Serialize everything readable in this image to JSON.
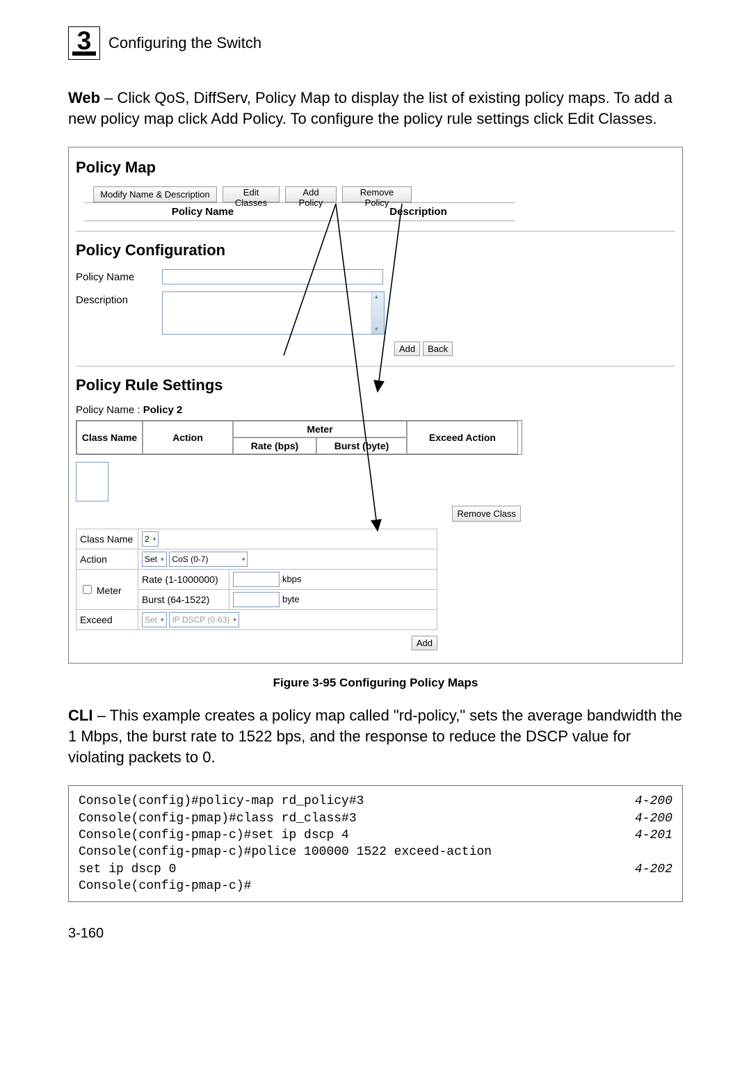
{
  "chapter": {
    "number": "3",
    "title": "Configuring the Switch"
  },
  "web_paragraph": {
    "bold": "Web",
    "rest": " – Click QoS, DiffServ, Policy Map to display the list of existing policy maps. To add a new policy map click Add Policy. To configure the policy rule settings click Edit Classes."
  },
  "policy_map": {
    "title": "Policy Map",
    "buttons": {
      "modify": "Modify Name & Description",
      "edit_classes": "Edit Classes",
      "add_policy": "Add Policy",
      "remove_policy": "Remove Policy"
    },
    "headers": {
      "name": "Policy Name",
      "desc": "Description"
    }
  },
  "policy_config": {
    "title": "Policy Configuration",
    "name_label": "Policy Name",
    "desc_label": "Description",
    "add": "Add",
    "back": "Back"
  },
  "policy_rule": {
    "title": "Policy Rule Settings",
    "name_prefix": "Policy Name : ",
    "name_value": "Policy 2",
    "grid_headers": {
      "class": "Class Name",
      "action": "Action",
      "meter": "Meter",
      "rate": "Rate (bps)",
      "burst": "Burst (byte)",
      "exceed": "Exceed Action"
    },
    "remove_class": "Remove Class",
    "rows": {
      "class_label": "Class Name",
      "class_value": "2",
      "action_label": "Action",
      "action_sel": "Set",
      "action_cos": "CoS (0-7)",
      "meter_label": "Meter",
      "rate_label": "Rate (1-1000000)",
      "rate_unit": "kbps",
      "burst_label": "Burst (64-1522)",
      "burst_unit": "byte",
      "exceed_label": "Exceed",
      "exceed_sel": "Set",
      "exceed_dscp": "IP DSCP (0-63)"
    },
    "add": "Add"
  },
  "figure_caption": "Figure 3-95  Configuring Policy Maps",
  "cli_paragraph": {
    "bold": "CLI",
    "rest": " – This example creates a policy map called \"rd-policy,\" sets the average bandwidth the 1 Mbps, the burst rate to 1522 bps, and the response to reduce the DSCP value for violating packets to 0."
  },
  "cli_lines": [
    {
      "cmd": "Console(config)#policy-map rd_policy#3",
      "ref": "4-200"
    },
    {
      "cmd": "Console(config-pmap)#class rd_class#3",
      "ref": "4-200"
    },
    {
      "cmd": "Console(config-pmap-c)#set ip dscp 4",
      "ref": "4-201"
    },
    {
      "cmd": "Console(config-pmap-c)#police 100000 1522 exceed-action ",
      "ref": ""
    },
    {
      "cmd": "set ip dscp 0",
      "ref": "4-202"
    },
    {
      "cmd": "Console(config-pmap-c)#",
      "ref": ""
    }
  ],
  "page_number": "3-160"
}
